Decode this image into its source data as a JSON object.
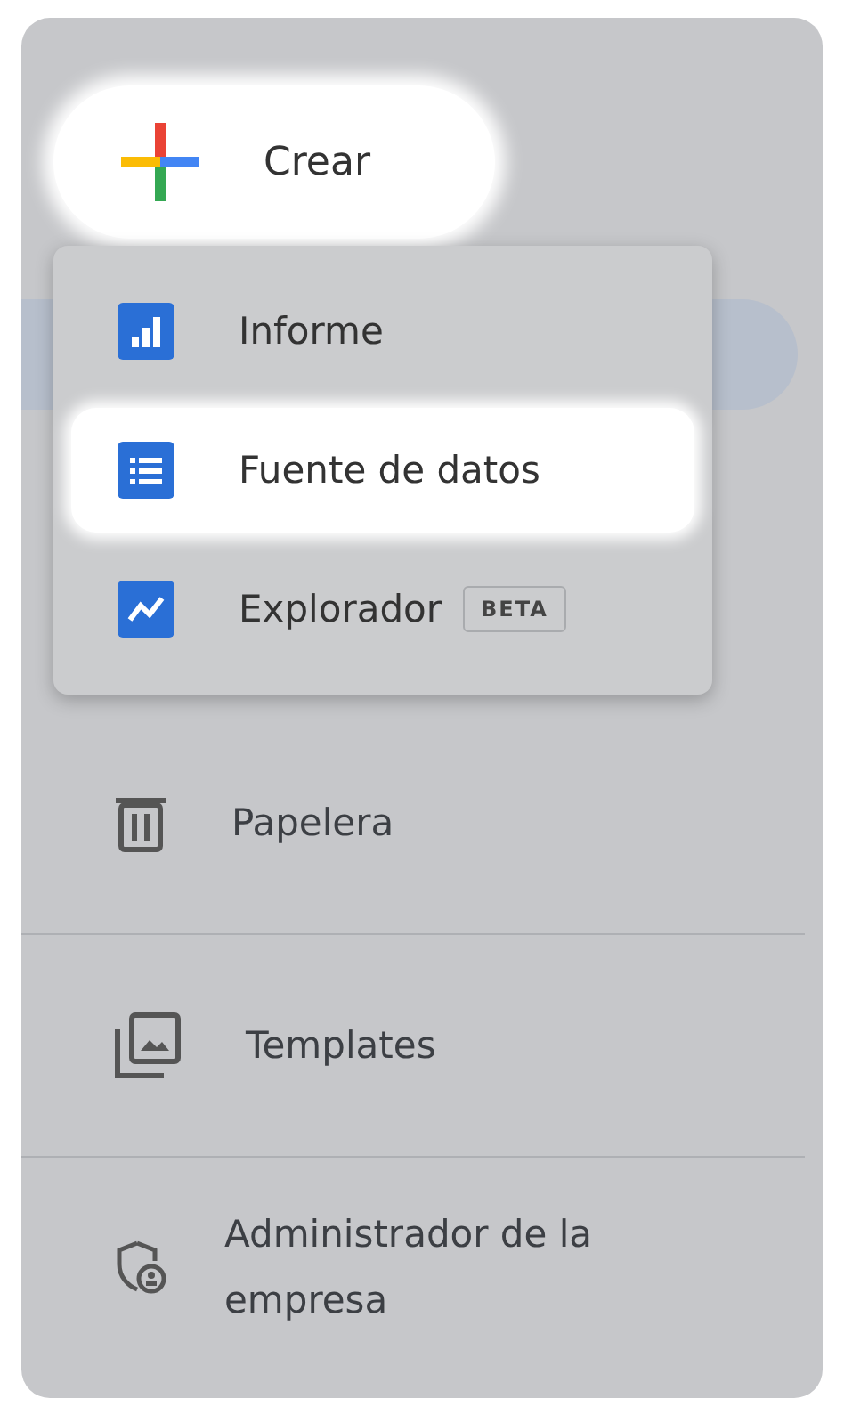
{
  "create_button": {
    "label": "Crear"
  },
  "create_menu": {
    "items": [
      {
        "kind": "report",
        "label": "Informe",
        "selected": false
      },
      {
        "kind": "datasource",
        "label": "Fuente de datos",
        "selected": true
      },
      {
        "kind": "explorer",
        "label": "Explorador",
        "badge": "BETA",
        "selected": false
      }
    ]
  },
  "nav": {
    "items": [
      {
        "kind": "trash",
        "label": "Papelera"
      },
      {
        "kind": "templates",
        "label": "Templates"
      },
      {
        "kind": "admin",
        "label": "Administrador de la empresa"
      }
    ]
  }
}
